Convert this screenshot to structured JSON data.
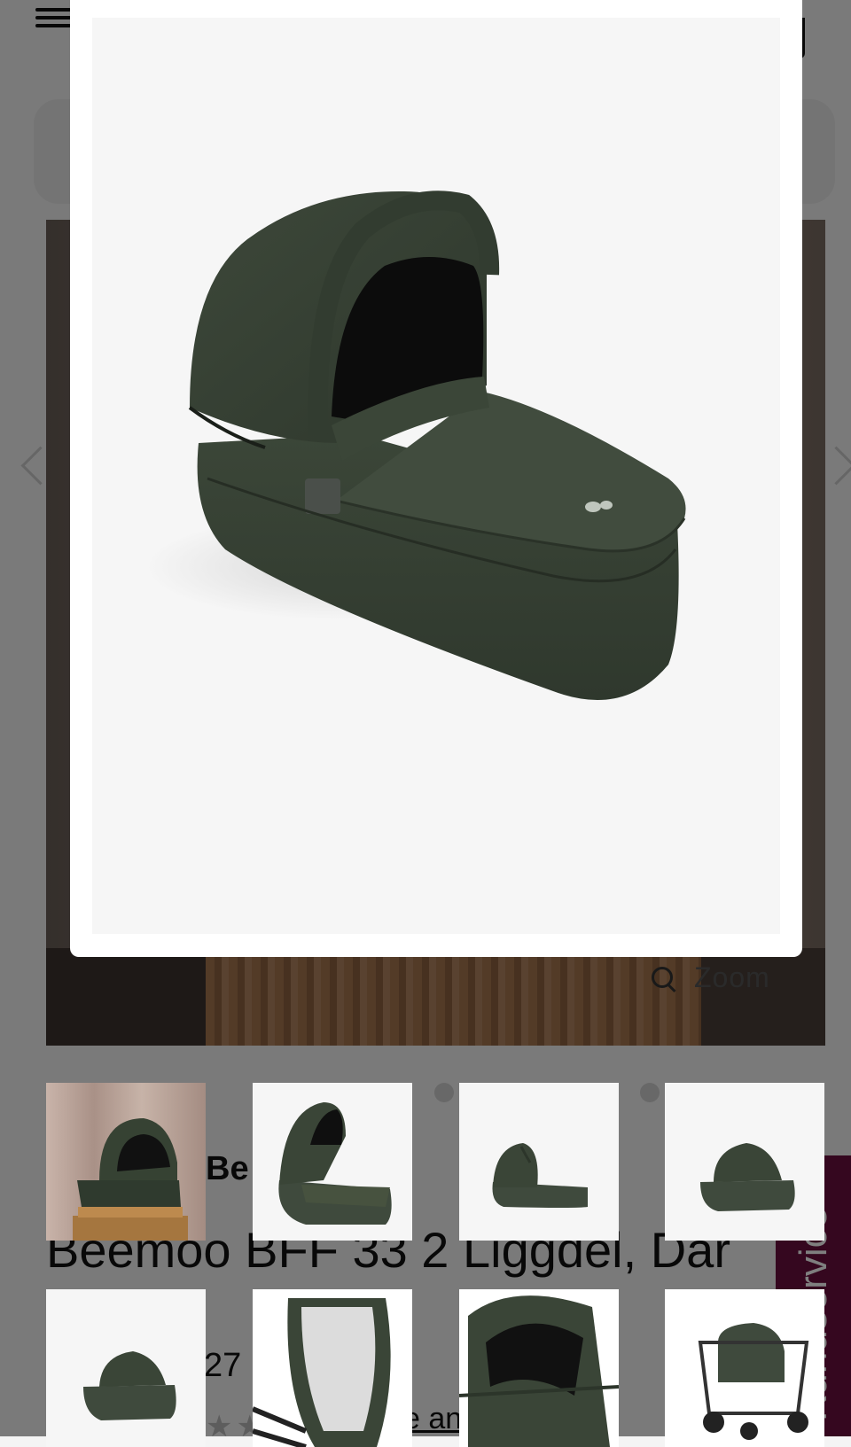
{
  "header": {
    "menu_icon": "hamburger-menu-icon",
    "cart_icon": "cart-icon"
  },
  "hero": {
    "zoom_label": "Zoom",
    "zoom_icon": "magnifier-icon"
  },
  "product": {
    "brand": "Be",
    "title": "Beemoo BFF 33 2 Liggdel, Dar",
    "price": "27",
    "review_link": "e an",
    "rating_visible": "★★"
  },
  "kundservice": {
    "label": "Kundservice",
    "color": "#6a0f3e"
  },
  "gallery": {
    "thumbnails": [
      {
        "alt": "bassinet-on-stand"
      },
      {
        "alt": "bassinet-front-angle"
      },
      {
        "alt": "bassinet-side"
      },
      {
        "alt": "bassinet-rear-angle"
      },
      {
        "alt": "bassinet-rear-low"
      },
      {
        "alt": "bassinet-top-view"
      },
      {
        "alt": "bassinet-hood-closeup"
      },
      {
        "alt": "stroller-with-bassinet"
      }
    ]
  },
  "modal": {
    "image_alt": "Beemoo BFF 33 2 bassinet, dark green"
  },
  "colors": {
    "product_green": "#3f4a3d",
    "overlay": "rgba(0,0,0,0.5)"
  }
}
